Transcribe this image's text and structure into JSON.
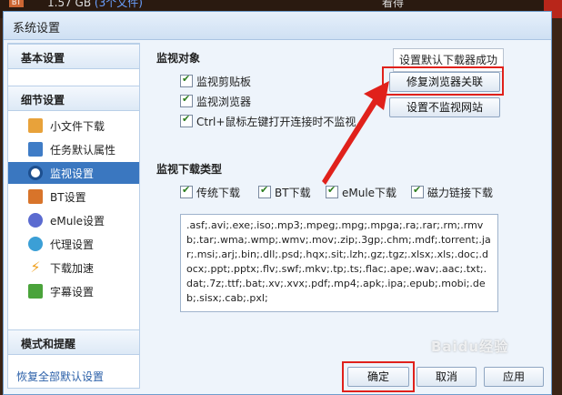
{
  "background": {
    "file_size": "1.57 GB",
    "file_count": "(3个文件)",
    "right_text": "看得",
    "badge": "BT"
  },
  "window": {
    "title": "系统设置"
  },
  "sidebar": {
    "section_basic": "基本设置",
    "section_detail": "细节设置",
    "items": [
      {
        "label": "小文件下载",
        "icon": "folder-download-icon",
        "color": "#e8a23a"
      },
      {
        "label": "任务默认属性",
        "icon": "task-list-icon",
        "color": "#3f7cc6"
      },
      {
        "label": "监视设置",
        "icon": "eye-monitor-icon",
        "color": "#ffffff"
      },
      {
        "label": "BT设置",
        "icon": "bt-package-icon",
        "color": "#d8742a"
      },
      {
        "label": "eMule设置",
        "icon": "emule-icon",
        "color": "#5b6bd0"
      },
      {
        "label": "代理设置",
        "icon": "proxy-globe-icon",
        "color": "#3b9fd6"
      },
      {
        "label": "下载加速",
        "icon": "lightning-icon",
        "color": "#f0a11f"
      },
      {
        "label": "字幕设置",
        "icon": "subtitle-icon",
        "color": "#4aa33b"
      }
    ],
    "section_mode": "模式和提醒",
    "restore_defaults": "恢复全部默认设置"
  },
  "monitor": {
    "heading": "监视对象",
    "options": [
      {
        "label": "监视剪贴板",
        "checked": true
      },
      {
        "label": "监视浏览器",
        "checked": true
      },
      {
        "label": "Ctrl+鼠标左键打开连接时不监视",
        "checked": true
      }
    ],
    "tooltip": "设置默认下载器成功",
    "repair_button": "修复浏览器关联",
    "no_monitor_button": "设置不监视网站"
  },
  "types": {
    "heading": "监视下载类型",
    "options": [
      {
        "label": "传统下载",
        "checked": true
      },
      {
        "label": "BT下载",
        "checked": true
      },
      {
        "label": "eMule下载",
        "checked": true
      },
      {
        "label": "磁力链接下载",
        "checked": true
      }
    ],
    "extensions": ".asf;.avi;.exe;.iso;.mp3;.mpeg;.mpg;.mpga;.ra;.rar;.rm;.rmvb;.tar;.wma;.wmp;.wmv;.mov;.zip;.3gp;.chm;.mdf;.torrent;.jar;.msi;.arj;.bin;.dll;.psd;.hqx;.sit;.lzh;.gz;.tgz;.xlsx;.xls;.doc;.docx;.ppt;.pptx;.flv;.swf;.mkv;.tp;.ts;.flac;.ape;.wav;.aac;.txt;.dat;.7z;.ttf;.bat;.xv;.xvx;.pdf;.mp4;.apk;.ipa;.epub;.mobi;.deb;.sisx;.cab;.pxl;"
  },
  "footer": {
    "ok": "确定",
    "cancel": "取消",
    "apply": "应用"
  },
  "watermark": "Baidu经验",
  "colors": {
    "accent": "#3a77c0",
    "highlight": "#e0211b"
  }
}
